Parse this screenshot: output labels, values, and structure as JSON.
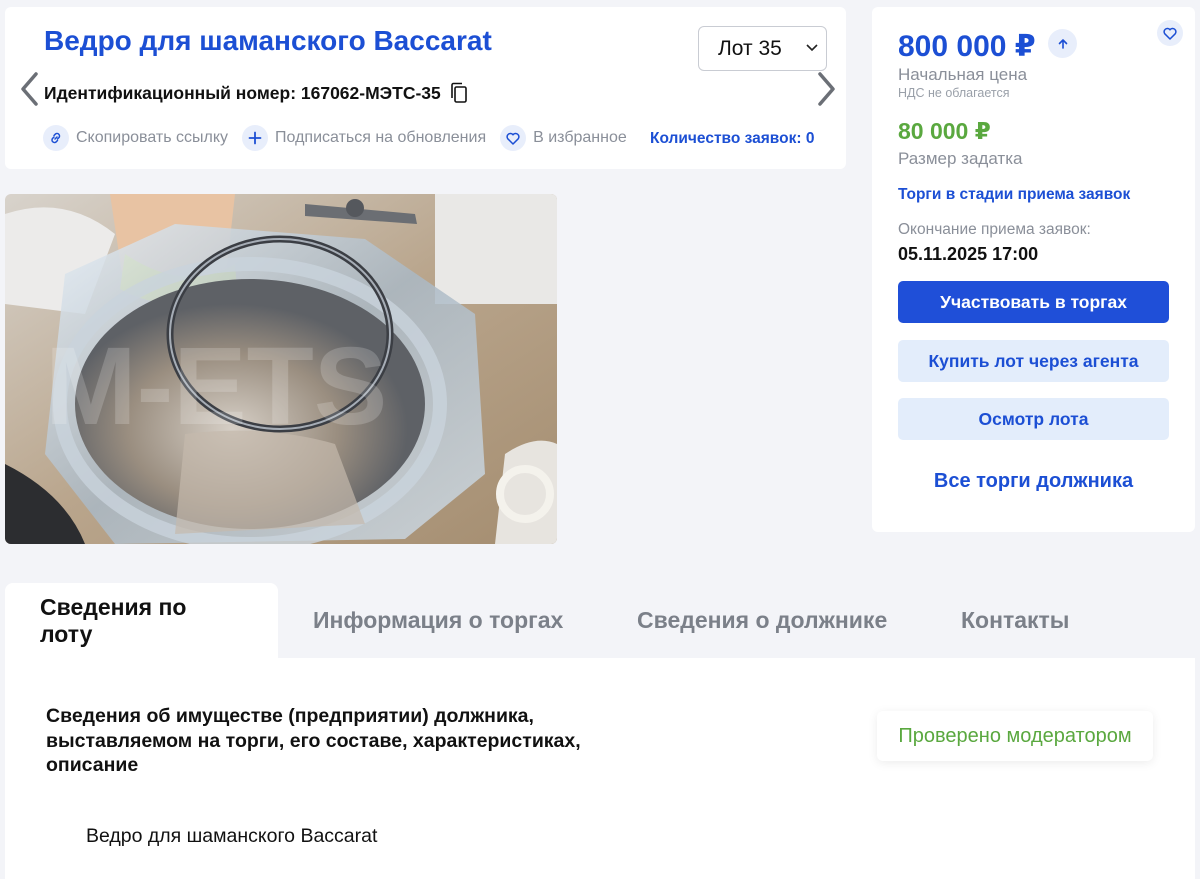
{
  "lot": {
    "title": "Ведро для шаманского Baccarat",
    "select_value": "Лот 35",
    "ident_label": "Идентификационный номер: 167062-МЭТС-35",
    "actions": [
      {
        "label": "Скопировать ссылку",
        "icon": "link-icon"
      },
      {
        "label": "Подписаться на обновления",
        "icon": "plus-icon"
      },
      {
        "label": "В избранное",
        "icon": "heart-icon"
      }
    ],
    "bids": "Количество заявок: 0"
  },
  "photo": {
    "watermark": "M-ETS"
  },
  "sidebar": {
    "price": "800 000 ₽",
    "price_label": "Начальная цена",
    "vat": "НДС не облагается",
    "deposit": "80 000 ₽",
    "deposit_label": "Размер задатка",
    "status": "Торги в стадии приема заявок",
    "deadline_label": "Окончание приема заявок:",
    "deadline": "05.11.2025 17:00",
    "btn_participate": "Участвовать в торгах",
    "btn_agent": "Купить лот через агента",
    "btn_inspect": "Осмотр лота",
    "all_debtor": "Все торги должника"
  },
  "tabs": [
    {
      "label": "Сведения по лоту"
    },
    {
      "label": "Информация о торгах"
    },
    {
      "label": "Сведения о должнике"
    },
    {
      "label": "Контакты"
    }
  ],
  "content": {
    "section_title": "Сведения об имуществе (предприятии) должника, выставляемом на торги, его составе, характеристиках, описание",
    "moderator": "Проверено модератором",
    "description": "Ведро для шаманского Baccarat"
  },
  "colors": {
    "accent": "#1c4fd4",
    "success": "#5aa83f",
    "background": "#f3f4f8"
  }
}
